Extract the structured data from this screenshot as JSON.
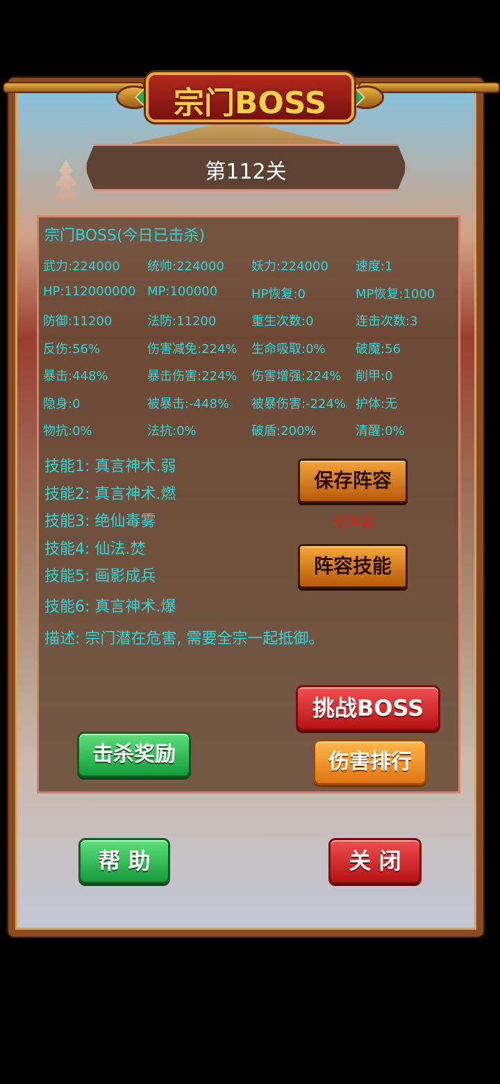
{
  "title": "宗门BOSS",
  "stage": "第112关",
  "boss_name": "宗门BOSS(今日已击杀)",
  "stats": [
    [
      "武力:224000",
      "统帅:224000",
      "妖力:224000",
      "速度:1"
    ],
    [
      "HP:112000000",
      "MP:100000",
      "HP恢复:0",
      "MP恢复:1000"
    ],
    [
      "防御:11200",
      "法防:11200",
      "重生次数:0",
      "连击次数:3"
    ],
    [
      "反伤:56%",
      "伤害减免:224%",
      "生命吸取:0%",
      "破魔:56"
    ],
    [
      "暴击:448%",
      "暴击伤害:224%",
      "伤害增强:224%",
      "削甲:0"
    ],
    [
      "隐身:0",
      "被暴击:-448%",
      "被暴伤害:-224%",
      "护体:无"
    ],
    [
      "物抗:0%",
      "法抗:0%",
      "破盾:200%",
      "清醒:0%"
    ]
  ],
  "skills": [
    "技能1: 真言神术.弱",
    "技能2: 真言神术.燃",
    "技能3: 绝仙毒雾",
    "技能4: 仙法.焚",
    "技能5: 画影成兵",
    "技能6: 真言神术.爆"
  ],
  "description": "描述: 宗门潜在危害, 需要全宗一起抵御。",
  "buttons": {
    "save_lineup": "保存阵容",
    "lineup_status": "无阵容",
    "lineup_skill": "阵容技能",
    "challenge": "挑战BOSS",
    "kill_reward": "击杀奖励",
    "damage_rank": "伤害排行",
    "help": "帮 助",
    "close": "关 闭"
  },
  "colors": {
    "stat_text": "#2fd7dc",
    "panel_bg": "#684a37",
    "status_red": "#e01c14"
  }
}
